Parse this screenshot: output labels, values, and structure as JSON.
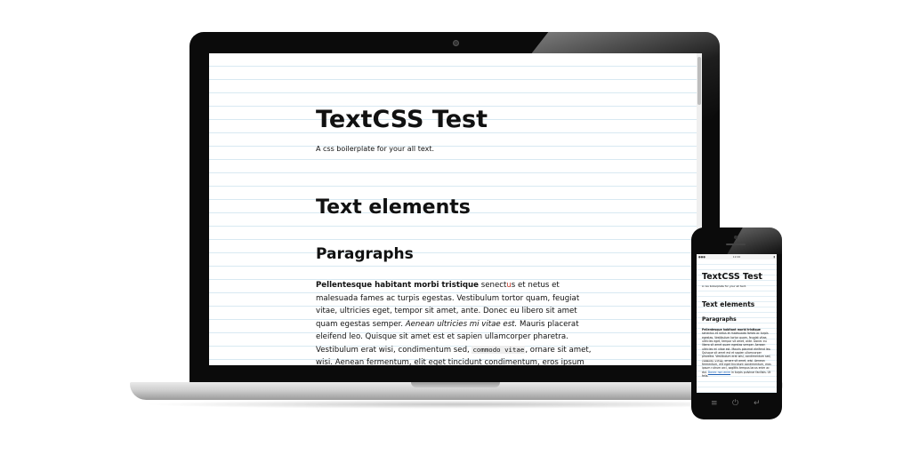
{
  "laptop_page": {
    "title": "TextCSS Test",
    "tagline": "A css boilerplate for your all text.",
    "section_heading": "Text elements",
    "sub_heading": "Paragraphs",
    "paragraph": {
      "bold_lead": "Pellentesque habitant morbi tristique",
      "text_1": " senect",
      "text_red": "u",
      "text_2": "s et netus et malesuada fames ac turpis egestas. Vestibulum tortor quam, feugiat vitae, ultricies eget, tempor sit amet, ante. Donec eu libero sit amet quam egestas semper. ",
      "italic": "Aenean ultricies mi vitae est.",
      "text_3": " Mauris placerat eleifend leo. Quisque sit amet est et sapien ullamcorper pharetra. Vestibulum erat wisi, condimentum sed, ",
      "code": "commodo vitae",
      "text_4": ", ornare sit amet, wisi. Aenean fermentum, elit eget tincidunt condimentum, eros ipsum rutrum orci, sagittis tempus lacus enim ac dui."
    }
  },
  "phone": {
    "status_time": "12:00",
    "status_left": "●●●",
    "status_right": "▮",
    "page": {
      "title": "TextCSS Test",
      "tagline": "A css boilerplate for your all text.",
      "section_heading": "Text elements",
      "sub_heading": "Paragraphs",
      "bold_lead": "Pellentesque habitant morbi tristique",
      "text_1": " senectus et netus et malesuada fames ac turpis egestas. Vestibulum tortor quam, feugiat vitae, ultricies eget, tempor sit amet, ante. Donec eu libero sit amet quam egestas semper. Aenean ultricies mi vitae est. Mauris placerat eleifend leo. Quisque sit amet est et sapien ullamcorper pharetra. Vestibulum erat wisi, condimentum sed, ",
      "code": "commodo vitae",
      "text_2": ", ornare sit amet, wisi. Aenean fermentum, elit eget tincidunt condimentum, eros ipsum rutrum orci, sagittis tempus lacus enim ac dui. ",
      "link": "Donec non enim",
      "text_3": " in turpis pulvinar facilisis. Ut felis."
    },
    "nav": {
      "menu_icon": "≡",
      "power_icon": "⏻",
      "back_icon": "↵"
    }
  },
  "icons": {
    "laptop_camera": "camera-dot",
    "phone_camera": "camera-dot",
    "phone_speaker": "speaker-slot"
  }
}
